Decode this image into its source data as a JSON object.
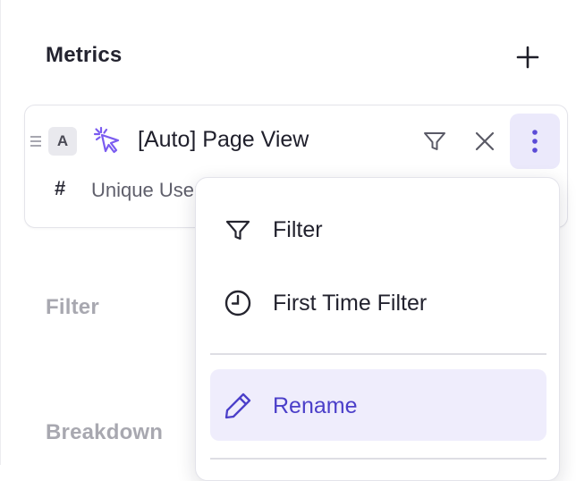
{
  "metrics": {
    "title": "Metrics",
    "add_icon": "plus-icon"
  },
  "metric_card": {
    "badge": "A",
    "event_icon": "auto-click-icon",
    "event_name": "[Auto] Page View",
    "measure_symbol": "#",
    "measure_label": "Unique Users",
    "actions": [
      "filter-icon",
      "close-icon",
      "more-vertical-icon"
    ]
  },
  "menu": {
    "items": [
      {
        "label": "Filter",
        "icon": "filter-icon"
      },
      {
        "label": "First Time Filter",
        "icon": "clock-icon"
      },
      {
        "label": "Rename",
        "icon": "pencil-icon",
        "highlighted": true
      }
    ]
  },
  "sections": {
    "filter_title": "Filter",
    "breakdown_title": "Breakdown"
  },
  "colors": {
    "accent": "#5b4bd6",
    "accent_bg": "#ebe9fb",
    "muted_heading": "#a8a8b0"
  }
}
